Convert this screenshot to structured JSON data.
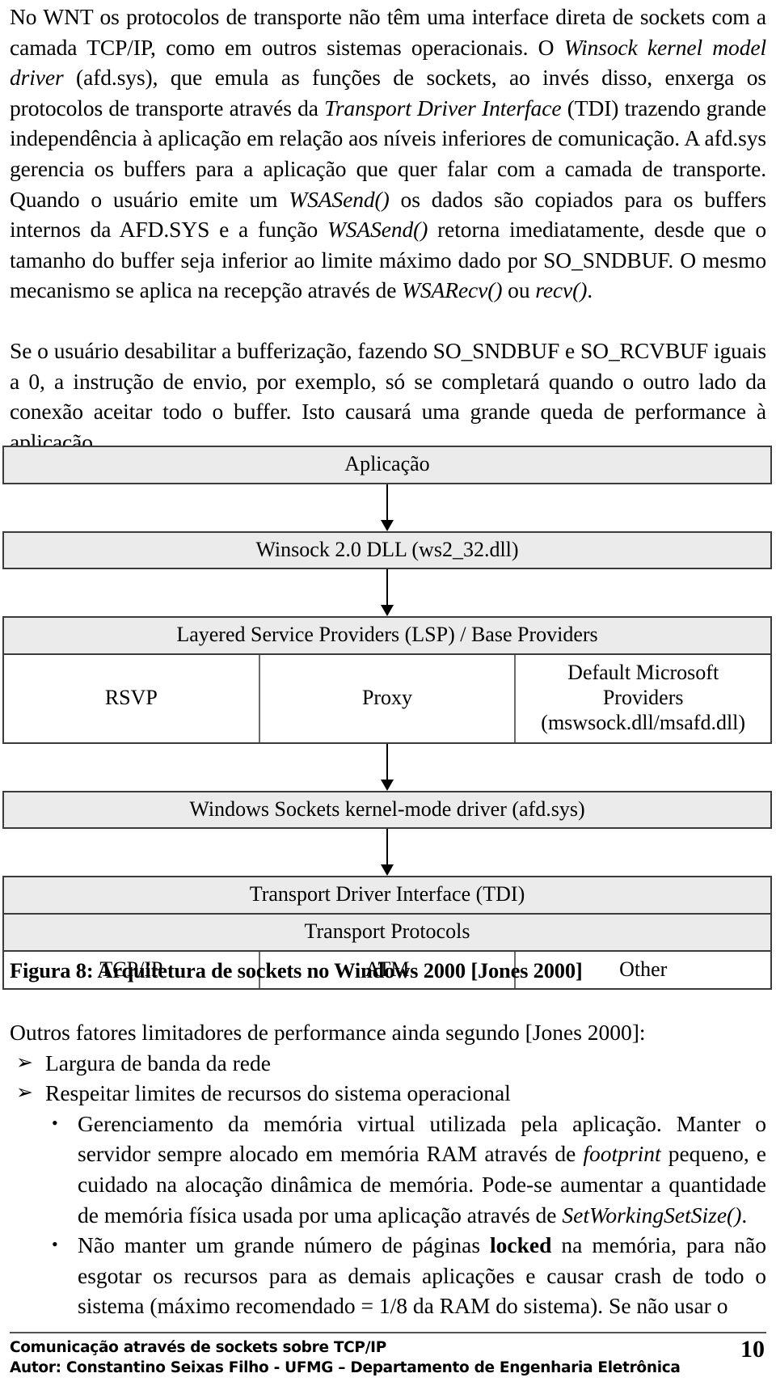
{
  "body": {
    "paragraphs": [
      {
        "id": "p1",
        "runs": [
          {
            "t": "No WNT os protocolos de transporte não têm uma interface direta de sockets com a camada TCP/IP, como em outros sistemas operacionais. O ",
            "s": "normal"
          },
          {
            "t": "Winsock kernel model driver",
            "s": "italic"
          },
          {
            "t": " (afd.sys), que emula as funções de sockets, ao invés disso, enxerga os protocolos de transporte através da ",
            "s": "normal"
          },
          {
            "t": "Transport Driver Interface",
            "s": "italic"
          },
          {
            "t": " (TDI) trazendo grande independência à aplicação em relação aos níveis inferiores de comunicação. A afd.sys  gerencia os buffers para a aplicação que quer falar com a camada de transporte.  Quando o usuário emite um ",
            "s": "normal"
          },
          {
            "t": "WSASend()",
            "s": "italic"
          },
          {
            "t": " os dados são copiados para os buffers internos da AFD.SYS e a função ",
            "s": "normal"
          },
          {
            "t": "WSASend()",
            "s": "italic"
          },
          {
            "t": " retorna imediatamente, desde que o tamanho do buffer seja inferior ao limite máximo dado por SO_SNDBUF. O mesmo mecanismo se aplica na recepção através de ",
            "s": "normal"
          },
          {
            "t": "WSARecv()",
            "s": "italic"
          },
          {
            "t": " ou ",
            "s": "normal"
          },
          {
            "t": "recv()",
            "s": "italic"
          },
          {
            "t": ".",
            "s": "normal"
          }
        ]
      },
      {
        "id": "p2",
        "runs": [
          {
            "t": "Se o usuário desabilitar a bufferização, fazendo SO_SNDBUF e SO_RCVBUF iguais a 0, a instrução de envio, por exemplo, só se completará quando o outro lado da conexão aceitar todo o buffer.  Isto causará uma grande queda de performance à aplicação.",
            "s": "normal"
          }
        ]
      }
    ]
  },
  "diagram": {
    "application": "Aplicação",
    "winsock_dll": "Winsock 2.0 DLL (ws2_32.dll)",
    "lsp_header": "Layered Service Providers (LSP) / Base Providers",
    "lsp_columns": [
      {
        "label": "RSVP",
        "lines": [
          "RSVP"
        ]
      },
      {
        "label": "Proxy",
        "lines": [
          "Proxy"
        ]
      },
      {
        "label": "Default Microsoft Providers (mswsock.dll/msafd.dll)",
        "lines": [
          "Default Microsoft",
          "Providers",
          "(mswsock.dll/msafd.dll)"
        ]
      }
    ],
    "afd_driver": "Windows Sockets kernel-mode driver (afd.sys)",
    "tdi": "Transport Driver Interface (TDI)",
    "transport_protocols": "Transport Protocols",
    "protocol_columns": [
      "TCP/IP",
      "ATM",
      "Other"
    ],
    "colors": {
      "box_fill": "#ebebeb",
      "box_border": "#3b3b3b",
      "plain_fill": "#ffffff"
    }
  },
  "caption": {
    "prefix": "Figura 8",
    "separator": ": ",
    "text": "Arquitetura de sockets no Windows 2000 [Jones 2000]"
  },
  "lower": {
    "intro": "Outros fatores limitadores de performance ainda segundo [Jones 2000]:",
    "level1_marker": "➢",
    "level2_marker": "•",
    "items": [
      {
        "marker": "➢",
        "runs": [
          {
            "t": "Largura de banda da rede",
            "s": "normal"
          }
        ]
      },
      {
        "marker": "➢",
        "runs": [
          {
            "t": "Respeitar limites de recursos do sistema operacional",
            "s": "normal"
          }
        ]
      }
    ],
    "subitems": [
      {
        "marker": "•",
        "runs": [
          {
            "t": "Gerenciamento da memória virtual utilizada pela aplicação. Manter o servidor sempre alocado em memória RAM através de ",
            "s": "normal"
          },
          {
            "t": "footprint",
            "s": "italic"
          },
          {
            "t": " pequeno, e cuidado na alocação dinâmica de memória. Pode-se aumentar a quantidade de memória física usada por uma aplicação através de ",
            "s": "normal"
          },
          {
            "t": "SetWorkingSetSize()",
            "s": "italic"
          },
          {
            "t": ".",
            "s": "normal"
          }
        ]
      },
      {
        "marker": "•",
        "runs": [
          {
            "t": "Não manter um grande número de páginas ",
            "s": "normal"
          },
          {
            "t": "locked",
            "s": "bold"
          },
          {
            "t": " na memória, para não esgotar os recursos para as demais aplicações e causar crash de todo o sistema (máximo recomendado = 1/8 da RAM do sistema). Se não usar o",
            "s": "normal"
          }
        ]
      }
    ]
  },
  "footer": {
    "line1": "Comunicação através de sockets sobre TCP/IP",
    "line2": "Autor: Constantino Seixas Filho - UFMG – Departamento de Engenharia Eletrônica",
    "page_number": "10"
  }
}
